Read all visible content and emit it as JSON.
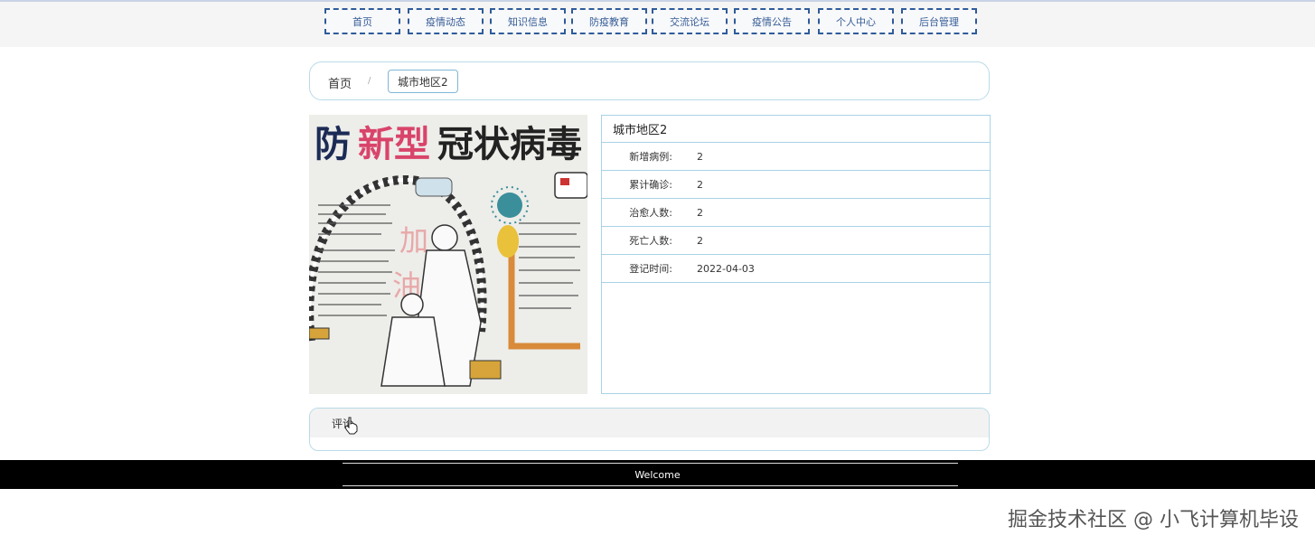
{
  "nav": {
    "items": [
      {
        "id": "home",
        "label": "首页"
      },
      {
        "id": "news",
        "label": "疫情动态"
      },
      {
        "id": "knowledge",
        "label": "知识信息"
      },
      {
        "id": "education",
        "label": "防疫教育"
      },
      {
        "id": "forum",
        "label": "交流论坛"
      },
      {
        "id": "notice",
        "label": "疫情公告"
      },
      {
        "id": "user-center",
        "label": "个人中心"
      },
      {
        "id": "admin",
        "label": "后台管理"
      }
    ]
  },
  "breadcrumb": {
    "home": "首页",
    "separator": "/",
    "current": "城市地区2"
  },
  "poster": {
    "title_a": "防",
    "title_b": "新型",
    "title_c": "冠状病毒",
    "cheer_1": "加",
    "cheer_2": "油"
  },
  "detail": {
    "title": "城市地区2",
    "rows": [
      {
        "label": "新增病例:",
        "value": "2"
      },
      {
        "label": "累计确诊:",
        "value": "2"
      },
      {
        "label": "治愈人数:",
        "value": "2"
      },
      {
        "label": "死亡人数:",
        "value": "2"
      },
      {
        "label": "登记时间:",
        "value": "2022-04-03"
      }
    ]
  },
  "comment": {
    "label": "评论"
  },
  "footer": {
    "text": "Welcome"
  },
  "watermark": {
    "text": "掘金技术社区 @ 小飞计算机毕设"
  }
}
